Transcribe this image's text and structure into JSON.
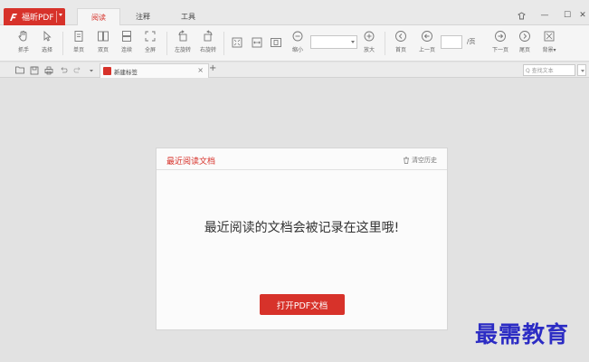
{
  "app": {
    "name": "福昕PDF",
    "brand_color": "#d7322a"
  },
  "tabs": [
    {
      "label": "阅读",
      "active": true
    },
    {
      "label": "注释",
      "active": false
    },
    {
      "label": "工具",
      "active": false
    }
  ],
  "window_controls": {
    "skin_icon": "skin-icon",
    "minimize": "—",
    "maximize": "☐",
    "close": "✕"
  },
  "toolbar": {
    "hand": "抓手",
    "select": "选择",
    "single_page": "单页",
    "double_page": "双页",
    "continuous": "连续",
    "fullscreen": "全屏",
    "rotate_left": "左旋转",
    "rotate_right": "右旋转",
    "zoom_out": "缩小",
    "zoom_in": "放大",
    "first_page": "首页",
    "prev_page": "上一页",
    "page_total": "/页",
    "next_page": "下一页",
    "last_page": "尾页",
    "background": "背景▾",
    "zoom_value": "",
    "page_value": ""
  },
  "doc_tab": {
    "label": "新建标签",
    "close": "×",
    "new": "+"
  },
  "search": {
    "placeholder": "Q 查找文本"
  },
  "recent": {
    "title": "最近阅读文档",
    "clear_label": "清空历史",
    "empty_message": "最近阅读的文档会被记录在这里哦!",
    "open_button": "打开PDF文档"
  },
  "watermark": "最需教育"
}
